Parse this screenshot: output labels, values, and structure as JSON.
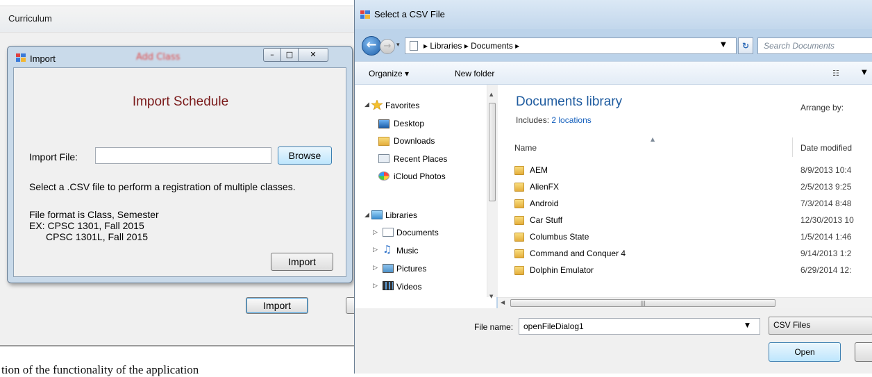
{
  "document": {
    "bottom_text": "tion of the functionality of the application"
  },
  "curriculum_window": {
    "title": "Curriculum",
    "import_button": "Import"
  },
  "import_dialog": {
    "title": "Import",
    "blurred_title": "Add Class",
    "heading": "Import Schedule",
    "file_label": "Import File:",
    "file_value": "",
    "browse_label": "Browse",
    "instruction": "Select a .CSV file to perform a registration of multiple classes.",
    "format_line": "File format is Class, Semester",
    "example_line1": "EX: CPSC 1301, Fall 2015",
    "example_line2": "CPSC 1301L, Fall 2015",
    "import_label": "Import",
    "caption_minimize": "–",
    "caption_maximize": "□",
    "caption_close": "✕"
  },
  "file_dialog": {
    "title": "Select a CSV File",
    "breadcrumbs": "▸ Libraries ▸ Documents ▸",
    "search_placeholder": "Search Documents",
    "toolbar": {
      "organize": "Organize ▾",
      "new_folder": "New folder"
    },
    "nav": {
      "favorites": "Favorites",
      "desktop": "Desktop",
      "downloads": "Downloads",
      "recent_places": "Recent Places",
      "icloud_photos": "iCloud Photos",
      "libraries": "Libraries",
      "documents": "Documents",
      "music": "Music",
      "pictures": "Pictures",
      "videos": "Videos"
    },
    "library_title": "Documents library",
    "includes_label": "Includes:",
    "includes_link": "2 locations",
    "arrange_by": "Arrange by:",
    "columns": {
      "name": "Name",
      "date_modified": "Date modified"
    },
    "files": [
      {
        "name": "AEM",
        "date": "8/9/2013 10:4"
      },
      {
        "name": "AlienFX",
        "date": "2/5/2013 9:25"
      },
      {
        "name": "Android",
        "date": "7/3/2014 8:48"
      },
      {
        "name": "Car Stuff",
        "date": "12/30/2013 10"
      },
      {
        "name": "Columbus State",
        "date": "1/5/2014 1:46"
      },
      {
        "name": "Command and Conquer 4",
        "date": "9/14/2013 1:2"
      },
      {
        "name": "Dolphin Emulator",
        "date": "6/29/2014 12:"
      }
    ],
    "file_name_label": "File name:",
    "file_name_value": "openFileDialog1",
    "file_type": "CSV Files",
    "open_label": "Open"
  },
  "colors": {
    "heading": "#7a1a1a",
    "library_title": "#1e5b9f",
    "link": "#1560bd"
  }
}
